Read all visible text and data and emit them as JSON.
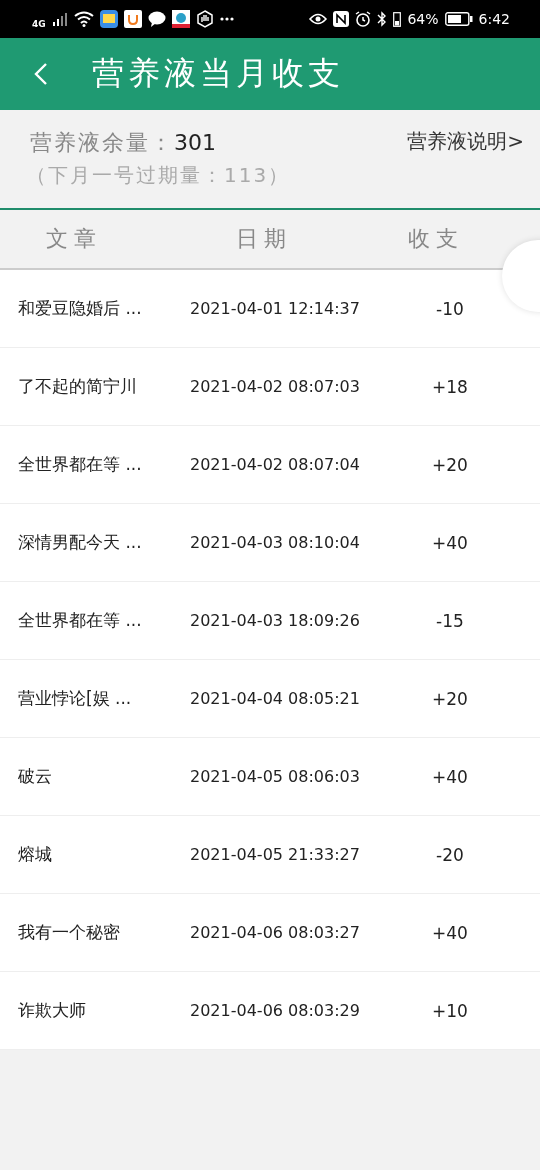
{
  "status_bar": {
    "network": "4G",
    "battery_percent": "64%",
    "time": "6:42"
  },
  "header": {
    "title": "营养液当月收支"
  },
  "summary": {
    "balance_label": "营养液余量：",
    "balance_value": "301",
    "expiry_note": "（下月一号过期量：113）",
    "info_link": "营养液说明>"
  },
  "table": {
    "columns": [
      "文章",
      "日期",
      "收支"
    ],
    "rows": [
      {
        "article": "和爱豆隐婚后 ...",
        "date": "2021-04-01 12:14:37",
        "amount": "-10"
      },
      {
        "article": "了不起的简宁川",
        "date": "2021-04-02 08:07:03",
        "amount": "+18"
      },
      {
        "article": "全世界都在等 ...",
        "date": "2021-04-02 08:07:04",
        "amount": "+20"
      },
      {
        "article": "深情男配今天 ...",
        "date": "2021-04-03 08:10:04",
        "amount": "+40"
      },
      {
        "article": "全世界都在等 ...",
        "date": "2021-04-03 18:09:26",
        "amount": "-15"
      },
      {
        "article": "营业悖论[娱 ...",
        "date": "2021-04-04 08:05:21",
        "amount": "+20"
      },
      {
        "article": "破云",
        "date": "2021-04-05 08:06:03",
        "amount": "+40"
      },
      {
        "article": "熔城",
        "date": "2021-04-05 21:33:27",
        "amount": "-20"
      },
      {
        "article": "我有一个秘密",
        "date": "2021-04-06 08:03:27",
        "amount": "+40"
      },
      {
        "article": "诈欺大师",
        "date": "2021-04-06 08:03:29",
        "amount": "+10"
      }
    ]
  }
}
